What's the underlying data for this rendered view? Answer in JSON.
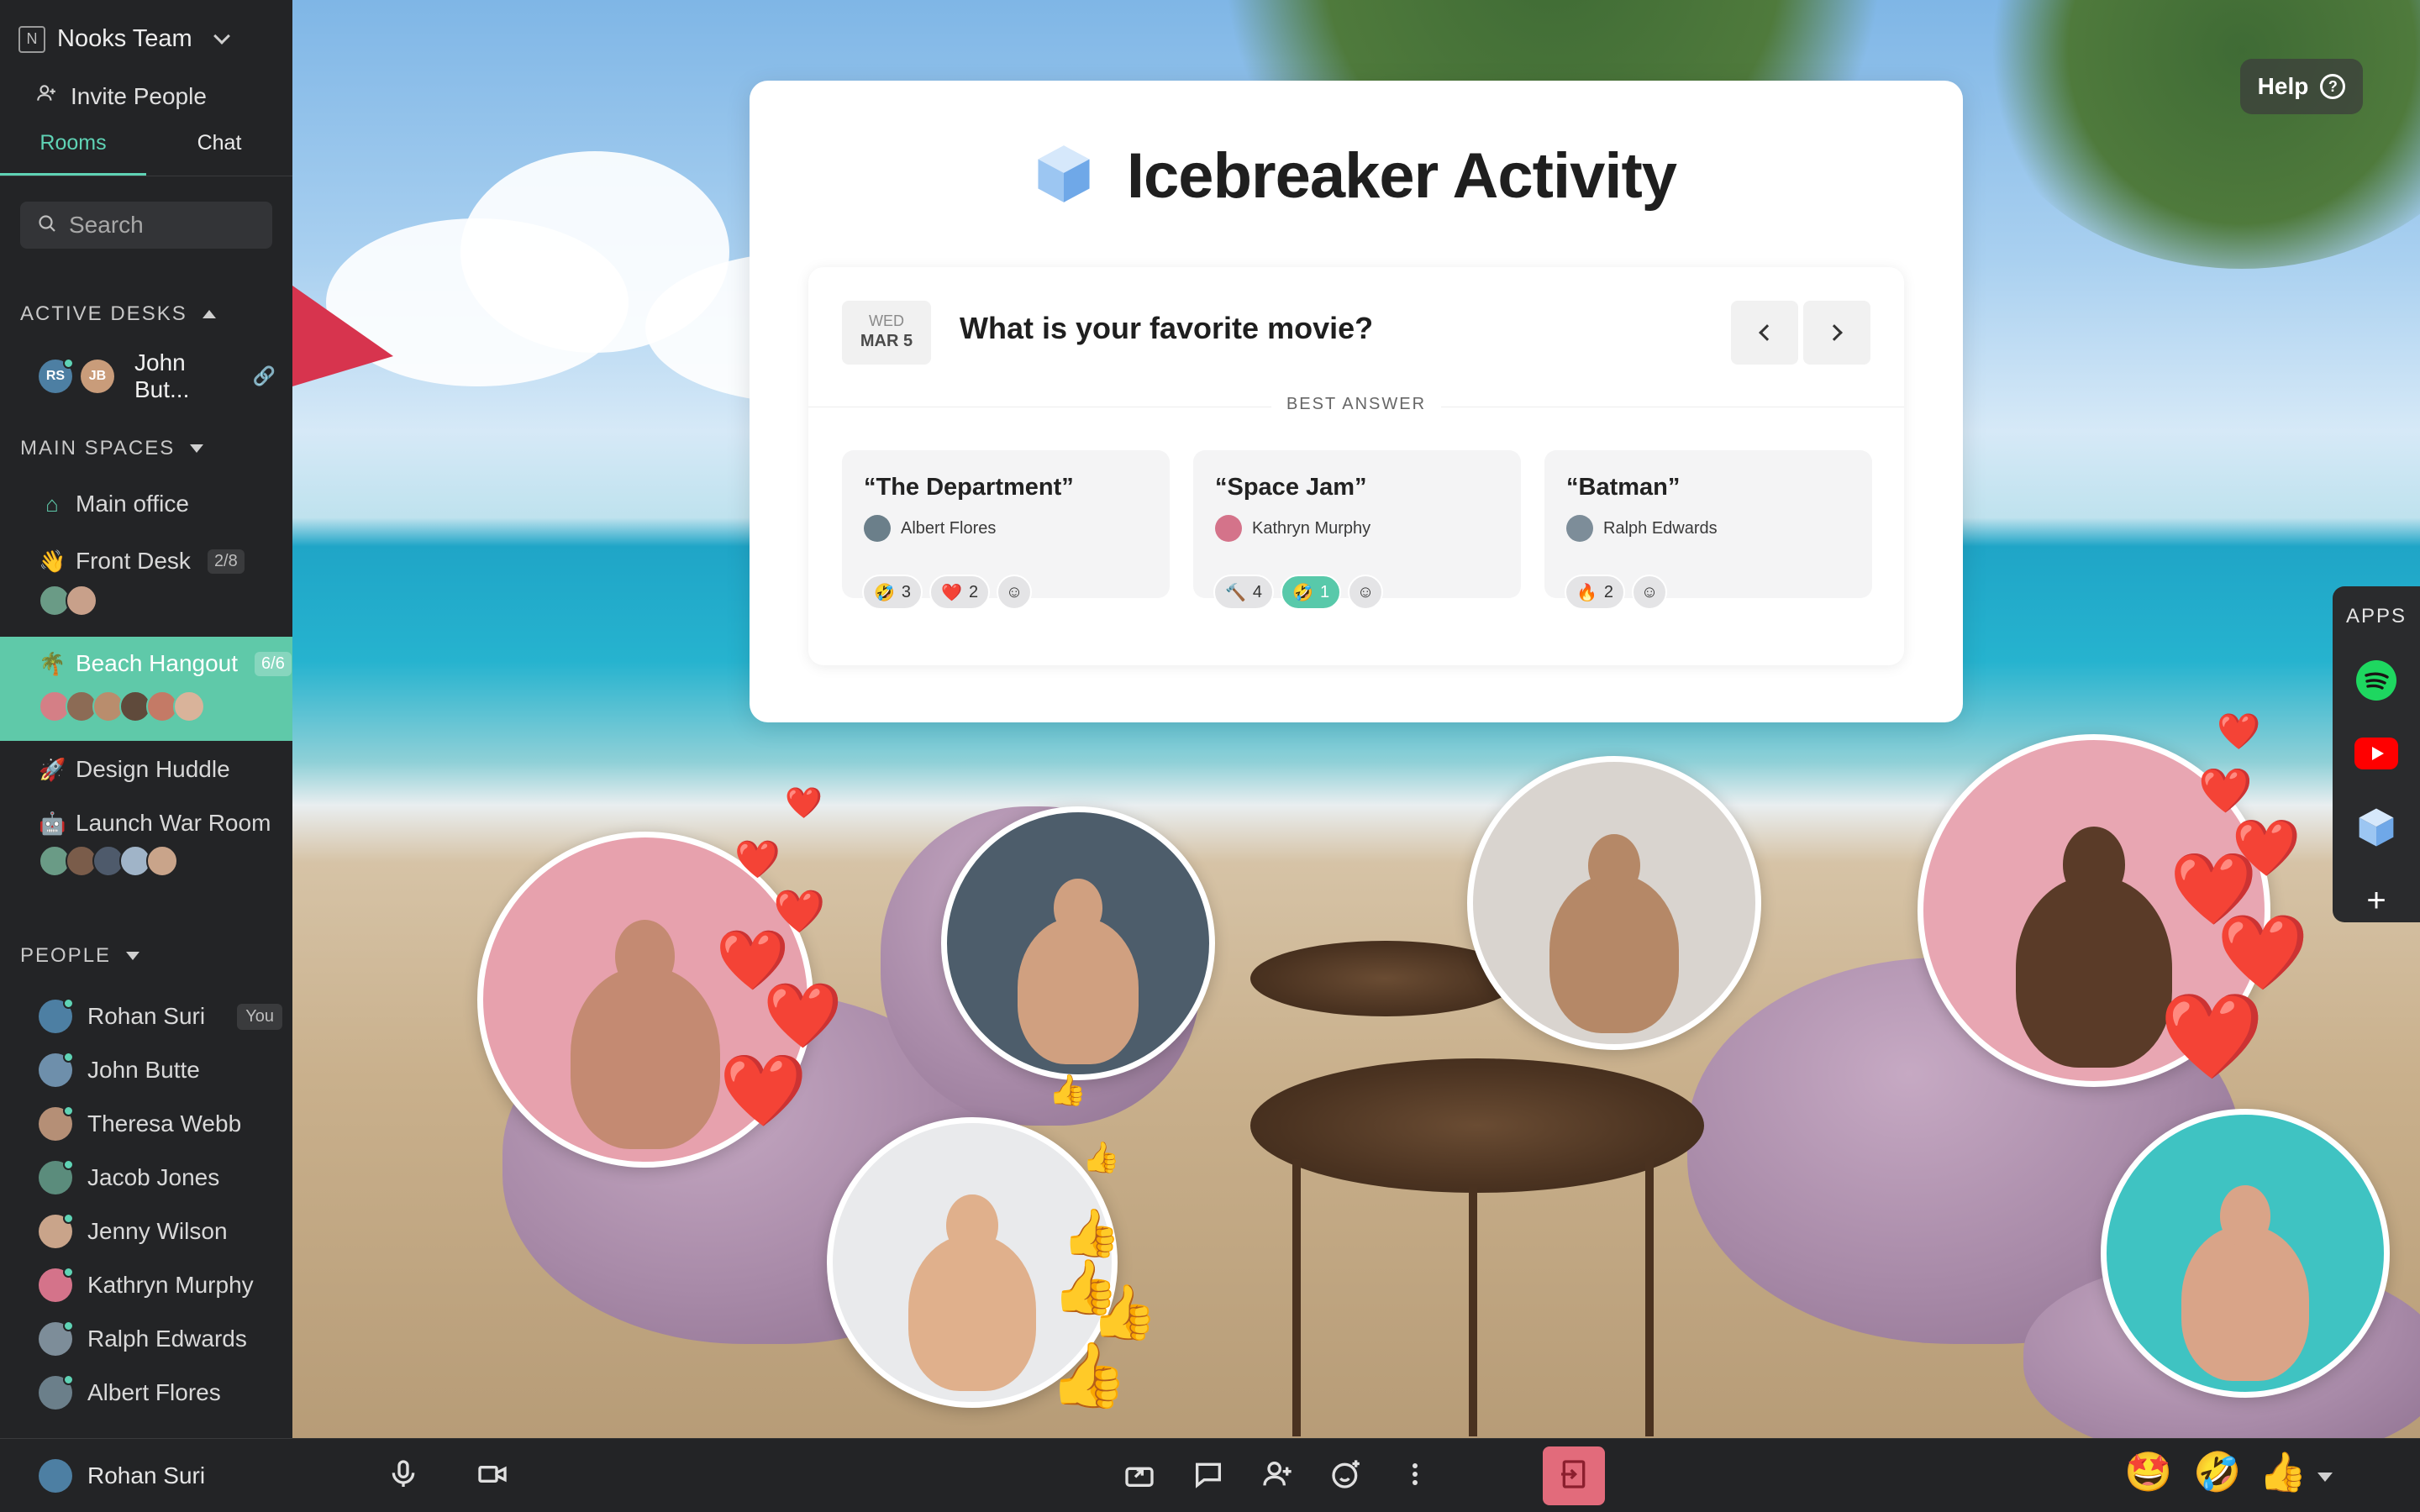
{
  "team": {
    "logo_letter": "N",
    "name": "Nooks Team"
  },
  "sidebar": {
    "invite_label": "Invite People",
    "tabs": [
      {
        "label": "Rooms",
        "active": true
      },
      {
        "label": "Chat",
        "active": false
      }
    ],
    "search_placeholder": "Search",
    "active_desks": {
      "heading": "ACTIVE DESKS",
      "items": [
        {
          "name": "John But..."
        }
      ]
    },
    "main_spaces": {
      "heading": "MAIN SPACES",
      "rooms": [
        {
          "emoji": "🏠",
          "name": "Main office",
          "count": ""
        },
        {
          "emoji": "👋",
          "name": "Front Desk",
          "count": "2/8"
        },
        {
          "emoji": "🌴",
          "name": "Beach Hangout",
          "count": "6/6",
          "active": true
        },
        {
          "emoji": "🚀",
          "name": "Design Huddle",
          "count": ""
        },
        {
          "emoji": "🤖",
          "name": "Launch War Room",
          "count": ""
        }
      ]
    },
    "people": {
      "heading": "PEOPLE",
      "list": [
        {
          "name": "Rohan Suri",
          "tag": "You"
        },
        {
          "name": "John Butte"
        },
        {
          "name": "Theresa Webb"
        },
        {
          "name": "Jacob Jones"
        },
        {
          "name": "Jenny Wilson"
        },
        {
          "name": "Kathryn Murphy"
        },
        {
          "name": "Ralph Edwards"
        },
        {
          "name": "Albert Flores"
        }
      ]
    },
    "me": {
      "name": "Rohan Suri"
    }
  },
  "help": {
    "label": "Help",
    "icon": "?"
  },
  "icebreaker": {
    "title": "Icebreaker Activity",
    "date": {
      "dow": "WED",
      "md": "MAR 5"
    },
    "question": "What is your favorite movie?",
    "best_answer_label": "BEST ANSWER",
    "answers": [
      {
        "text": "“The Department”",
        "author": "Albert Flores",
        "reactions": [
          {
            "emoji": "🤣",
            "count": "3"
          },
          {
            "emoji": "❤️",
            "count": "2"
          }
        ]
      },
      {
        "text": "“Space Jam”",
        "author": "Kathryn Murphy",
        "reactions": [
          {
            "emoji": "🔨",
            "count": "4"
          },
          {
            "emoji": "🤣",
            "count": "1",
            "mine": true
          }
        ]
      },
      {
        "text": "“Batman”",
        "author": "Ralph Edwards",
        "reactions": [
          {
            "emoji": "🔥",
            "count": "2"
          }
        ]
      }
    ]
  },
  "apps": {
    "title": "APPS",
    "items": [
      "spotify-icon",
      "youtube-icon",
      "icebreaker-icon"
    ]
  },
  "bottom_bar": {
    "quick_reactions": [
      "🤩",
      "🤣",
      "👍"
    ]
  },
  "colors": {
    "accent": "#5fc9a9",
    "leave": "#e26b7b",
    "sidebar": "#232426"
  }
}
